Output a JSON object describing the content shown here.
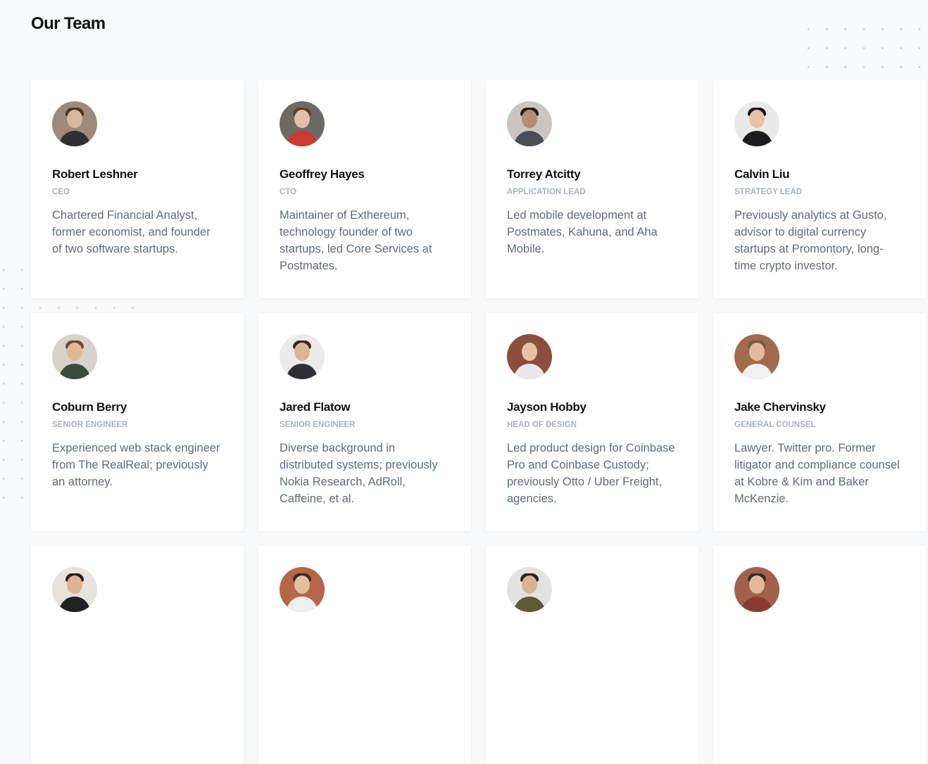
{
  "page": {
    "title": "Our Team"
  },
  "team": [
    {
      "name": "Robert Leshner",
      "role": "CEO",
      "bio": "Chartered Financial Analyst, former economist, and founder of two software startups.",
      "avatar": {
        "bg": "#9d8a7a",
        "skin": "#d9b8a0",
        "hair": "#4a3526",
        "shirt": "#2f3033"
      }
    },
    {
      "name": "Geoffrey Hayes",
      "role": "CTO",
      "bio": "Maintainer of Exthereum, technology founder of two startups, led Core Services at Postmates.",
      "avatar": {
        "bg": "#6d6a66",
        "skin": "#e2bfa6",
        "hair": "#5a4030",
        "shirt": "#c93a2f"
      }
    },
    {
      "name": "Torrey Atcitty",
      "role": "Application Lead",
      "bio": "Led mobile development at Postmates, Kahuna, and Aha Mobile.",
      "avatar": {
        "bg": "#c9c5c0",
        "skin": "#b58d70",
        "hair": "#1e1c1b",
        "shirt": "#4a4f57"
      }
    },
    {
      "name": "Calvin Liu",
      "role": "Strategy Lead",
      "bio": "Previously analytics at Gusto, advisor to digital currency startups at Promontory, long-time crypto investor.",
      "avatar": {
        "bg": "#e9e9e7",
        "skin": "#e6c3a3",
        "hair": "#151515",
        "shirt": "#1c1c1e"
      }
    },
    {
      "name": "Coburn Berry",
      "role": "Senior Engineer",
      "bio": "Experienced web stack engineer from The RealReal; previously an attorney.",
      "avatar": {
        "bg": "#d7d2cc",
        "skin": "#e0b898",
        "hair": "#6b4a33",
        "shirt": "#3b4c3e"
      }
    },
    {
      "name": "Jared Flatow",
      "role": "Senior Engineer",
      "bio": "Diverse background in distributed systems; previously Nokia Research, AdRoll, Caffeine, et al.",
      "avatar": {
        "bg": "#ecebe9",
        "skin": "#dcb597",
        "hair": "#3a2a20",
        "shirt": "#2d2f33"
      }
    },
    {
      "name": "Jayson Hobby",
      "role": "Head of Design",
      "bio": "Led product design for Coinbase Pro and Coinbase Custody; previously Otto / Uber Freight, agencies.",
      "avatar": {
        "bg": "#8c4e3c",
        "skin": "#e7c2a4",
        "hair": "#7a5a40",
        "shirt": "#e8e8ea"
      }
    },
    {
      "name": "Jake Chervinsky",
      "role": "General Counsel",
      "bio": "Lawyer. Twitter pro. Former litigator and compliance counsel at Kobre & Kim and Baker McKenzie.",
      "avatar": {
        "bg": "#a46a4e",
        "skin": "#e3bc9c",
        "hair": "#6f5a4a",
        "shirt": "#f1f1f2"
      }
    },
    {
      "name": "",
      "role": "",
      "bio": "",
      "avatar": {
        "bg": "#e6e3df",
        "skin": "#dcb391",
        "hair": "#2a211c",
        "shirt": "#202124"
      }
    },
    {
      "name": "",
      "role": "",
      "bio": "",
      "avatar": {
        "bg": "#b5664a",
        "skin": "#e4bf9f",
        "hair": "#3a2b22",
        "shirt": "#efefef"
      }
    },
    {
      "name": "",
      "role": "",
      "bio": "",
      "avatar": {
        "bg": "#e2e2e0",
        "skin": "#d9b293",
        "hair": "#2c2320",
        "shirt": "#5d5a37"
      }
    },
    {
      "name": "",
      "role": "",
      "bio": "",
      "avatar": {
        "bg": "#a2614a",
        "skin": "#e1b998",
        "hair": "#3b2b22",
        "shirt": "#8a3b2f"
      }
    }
  ]
}
